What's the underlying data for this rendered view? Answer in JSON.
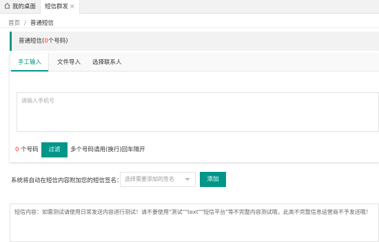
{
  "tabs": {
    "home_label": "我的桌面",
    "active_label": "短信群发",
    "close_symbol": "×"
  },
  "breadcrumb": {
    "home": "首页",
    "separator": "/",
    "current": "普通短信"
  },
  "section_title": {
    "prefix": "普通短信(",
    "count": "0",
    "suffix": "个号码)"
  },
  "card_tabs": [
    "手工输入",
    "文件导入",
    "选择联系人"
  ],
  "phone_input": {
    "placeholder": "请输入手机号"
  },
  "count_row": {
    "count": "0",
    "unit": " 个号码",
    "filter_label": "过滤",
    "hint": "多个号码请用(换行)回车隔开"
  },
  "signature": {
    "label": "系统将自动在短信内容附加您的短信签名：",
    "placeholder": "选择需要添加的签名",
    "add_label": "添加"
  },
  "content": {
    "placeholder": "短信内容：如需测试请使用日常发送内容进行测试！请不要使用\"测试\"\"text\"\"短信平台\"等不完整内容测试哦，此类不完整信息运营商不予发送哦！"
  },
  "colors": {
    "accent": "#009688",
    "count_red": "#ff2a2a"
  },
  "icons": {
    "home": "home-icon",
    "dropdown": "chevron-down-icon"
  }
}
